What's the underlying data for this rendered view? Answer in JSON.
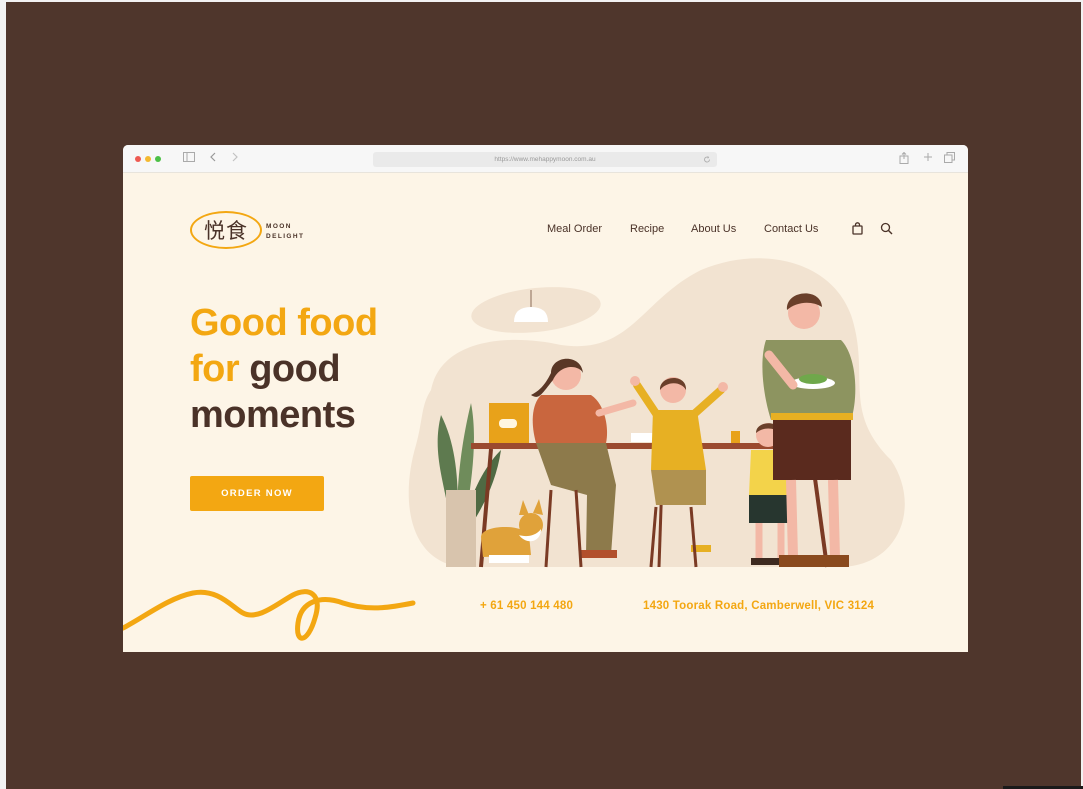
{
  "browser": {
    "url": "https://www.mehappymoon.com.au"
  },
  "brand": {
    "logo_chinese": "悦食",
    "logo_line1": "MOON",
    "logo_line2": "DELIGHT",
    "accent_color": "#f3a712",
    "text_color": "#4a3228"
  },
  "nav": {
    "items": [
      "Meal Order",
      "Recipe",
      "About Us",
      "Contact Us"
    ],
    "icons": [
      "shopping-bag-icon",
      "search-icon"
    ]
  },
  "hero": {
    "line1": "Good food",
    "line2_accent": "for",
    "line2_rest": "good",
    "line3": "moments",
    "cta_label": "ORDER NOW"
  },
  "footer": {
    "phone": "+ 61 450 144 480",
    "address": "1430 Toorak Road, Camberwell, VIC 3124"
  }
}
